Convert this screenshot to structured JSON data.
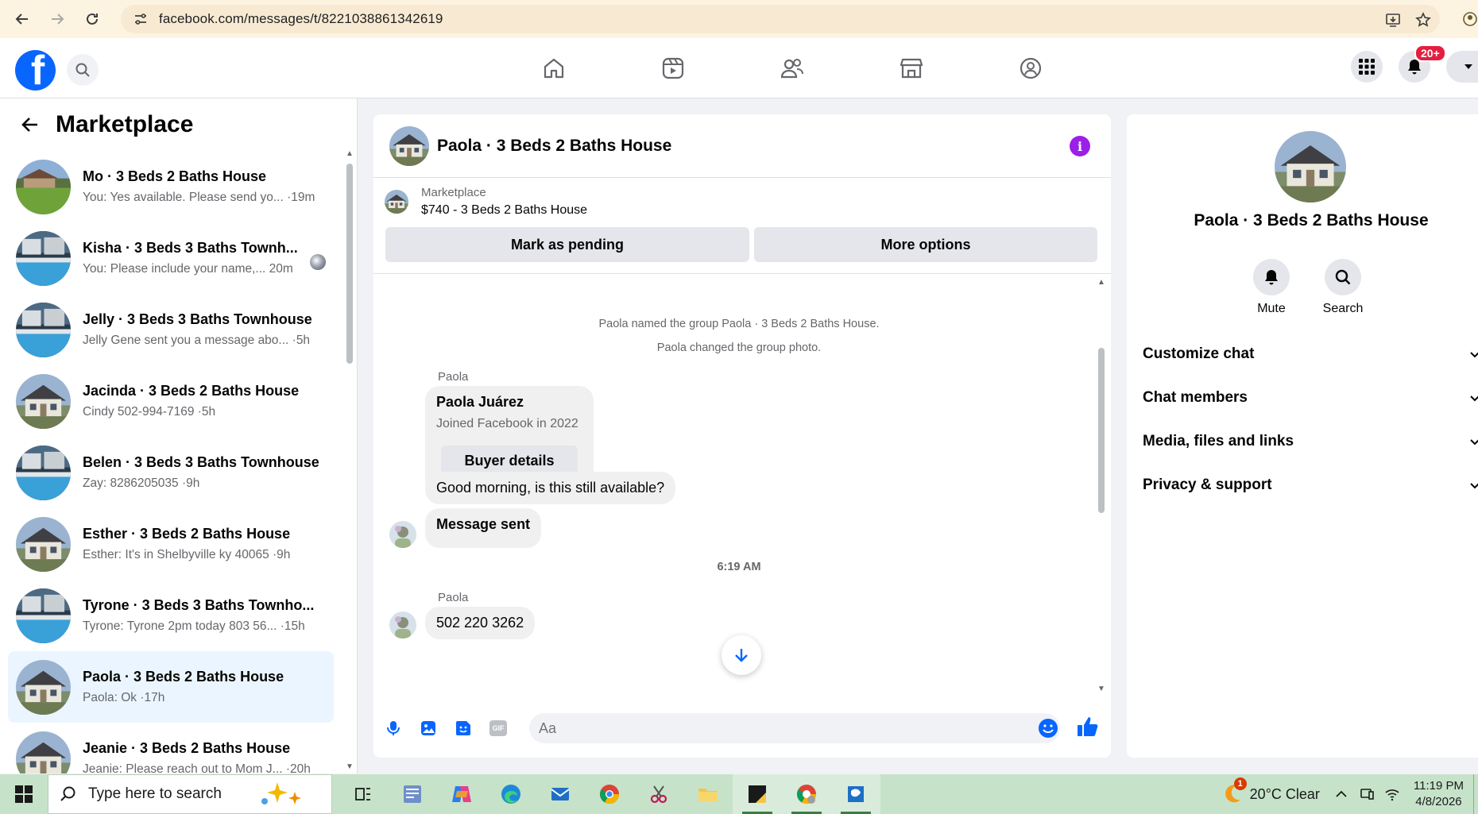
{
  "browser": {
    "url": "facebook.com/messages/t/8221038861342619"
  },
  "header": {
    "logo_letter": "f",
    "notification_badge": "20+",
    "nav_tabs": [
      "home",
      "video",
      "friends",
      "marketplace",
      "groups"
    ]
  },
  "sidebar": {
    "title": "Marketplace",
    "threads": [
      {
        "title": "Mo · 3 Beds 2 Baths House",
        "subtitle": "You: Yes available. Please send yo... ·19m",
        "thumb": "lawn"
      },
      {
        "title": "Kisha · 3 Beds 3 Baths Townh...",
        "subtitle": "You: Please include your name,... 20m",
        "thumb": "pool"
      },
      {
        "title": "Jelly · 3 Beds 3 Baths Townhouse",
        "subtitle": "Jelly Gene sent you a message abo... ·5h",
        "thumb": "pool"
      },
      {
        "title": "Jacinda · 3 Beds 2 Baths House",
        "subtitle": "Cindy 502-994-7169 ·5h",
        "thumb": "house"
      },
      {
        "title": "Belen · 3 Beds 3 Baths Townhouse",
        "subtitle": "Zay: 8286205035 ·9h",
        "thumb": "pool"
      },
      {
        "title": "Esther · 3 Beds 2 Baths House",
        "subtitle": "Esther: It's in Shelbyville ky 40065 ·9h",
        "thumb": "house"
      },
      {
        "title": "Tyrone · 3 Beds 3 Baths Townho...",
        "subtitle": "Tyrone: Tyrone 2pm today 803 56... ·15h",
        "thumb": "pool"
      },
      {
        "title": "Paola · 3 Beds 2 Baths House",
        "subtitle": "Paola: Ok ·17h",
        "thumb": "house",
        "active": true
      },
      {
        "title": "Jeanie · 3 Beds 2 Baths House",
        "subtitle": "Jeanie: Please reach out to Mom J... ·20h",
        "thumb": "house"
      }
    ]
  },
  "chat": {
    "title": "Paola · 3 Beds 2 Baths House",
    "marketplace_label": "Marketplace",
    "listing": "$740 - 3 Beds 2 Baths House",
    "mark_pending": "Mark as pending",
    "more_options": "More options",
    "sys_named": "Paola named the group Paola · 3 Beds 2 Baths House.",
    "sys_photo": "Paola changed the group photo.",
    "sender_1": "Paola",
    "card_name": "Paola Juárez",
    "card_joined": "Joined Facebook in 2022",
    "card_button": "Buyer details",
    "msg_1": "Good morning, is this still available?",
    "msg_2": "Message sent",
    "time_label": "6:19 AM",
    "sender_2": "Paola",
    "msg_3": "502 220 3262",
    "input_placeholder": "Aa"
  },
  "info_panel": {
    "title": "Paola · 3 Beds 2 Baths House",
    "mute": "Mute",
    "search": "Search",
    "sections": [
      "Customize chat",
      "Chat members",
      "Media, files and links",
      "Privacy & support"
    ]
  },
  "taskbar": {
    "search_placeholder": "Type here to search",
    "weather": "20°C  Clear",
    "weather_badge": "1",
    "time": "11:19 PM",
    "date": "4/8/2026"
  },
  "colors": {
    "fb_blue": "#0866ff",
    "info_purple": "#9b1fe8",
    "active_thread": "#ebf5ff",
    "taskbar": "#c6e3c9"
  }
}
